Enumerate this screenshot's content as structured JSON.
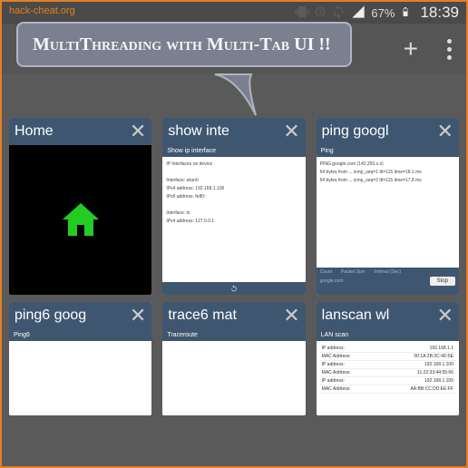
{
  "watermark": "hack-cheat.org",
  "status": {
    "battery_pct": "67%",
    "time": "18:39"
  },
  "speech_bubble": "MultiThreading with Multi-Tab UI !!",
  "tabs": [
    {
      "title": "Home",
      "type": "home"
    },
    {
      "title": "show inte",
      "sub": "Show ip interface",
      "body": "IP Interfaces on device\n\nInterface: wlan0\nIPv4 address: 192.168.1.105\nIPv6 address: fe80::\n\nInterface: lo\nIPv4 address: 127.0.0.1"
    },
    {
      "title": "ping googl",
      "sub": "Ping",
      "body": "PING google.com (142.250.x.x)\n64 bytes from ... icmp_seq=1 ttl=115 time=18.1 ms\n64 bytes from ... icmp_seq=2 ttl=115 time=17.8 ms",
      "ping_labels": [
        "Count",
        "Packet Size",
        "Interval (Sec)"
      ],
      "stop": "Stop"
    },
    {
      "title": "ping6 goog",
      "sub": "Ping6",
      "body": ""
    },
    {
      "title": "trace6 mat",
      "sub": "Traceroute",
      "body": ""
    },
    {
      "title": "lanscan wl",
      "sub": "LAN scan",
      "rows": [
        [
          "IP address:",
          "192.168.1.1"
        ],
        [
          "MAC Address:",
          "00:1A:2B:3C:4D:5E"
        ],
        [
          "IP address:",
          "192.168.1.100"
        ],
        [
          "MAC Address:",
          "11:22:33:44:55:66"
        ],
        [
          "IP address:",
          "192.168.1.105"
        ],
        [
          "MAC Address:",
          "AA:BB:CC:DD:EE:FF"
        ]
      ]
    }
  ]
}
